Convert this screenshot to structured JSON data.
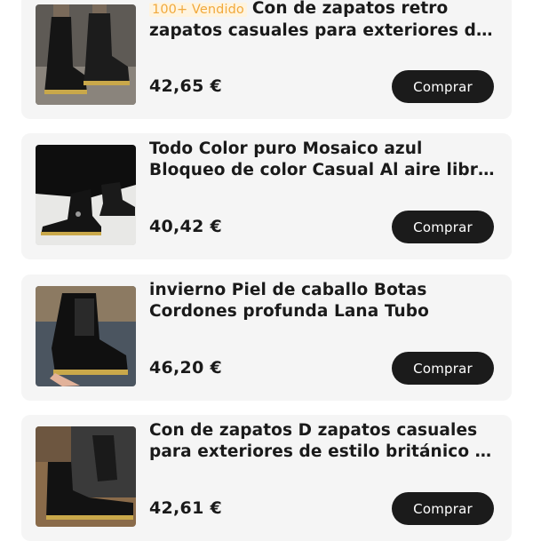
{
  "products": [
    {
      "badge": "100+ Vendido",
      "title": "Con de zapatos retro zapatos casuales para exteriores de estilo británico",
      "price": "42,65 €",
      "buy_label": "Comprar"
    },
    {
      "badge": "",
      "title": "Todo Color puro Mosaico azul Bloqueo de color Casual Al aire libre campo negro",
      "price": "40,42 €",
      "buy_label": "Comprar"
    },
    {
      "badge": "",
      "title": "invierno Piel de caballo Botas Cordones profunda Lana Tubo",
      "price": "46,20 €",
      "buy_label": "Comprar"
    },
    {
      "badge": "",
      "title": "Con de zapatos D zapatos casuales para exteriores de estilo británico al aire libre",
      "price": "42,61 €",
      "buy_label": "Comprar"
    }
  ],
  "icons": [
    "boot-photo",
    "boot-photo",
    "boot-photo",
    "boot-photo"
  ]
}
